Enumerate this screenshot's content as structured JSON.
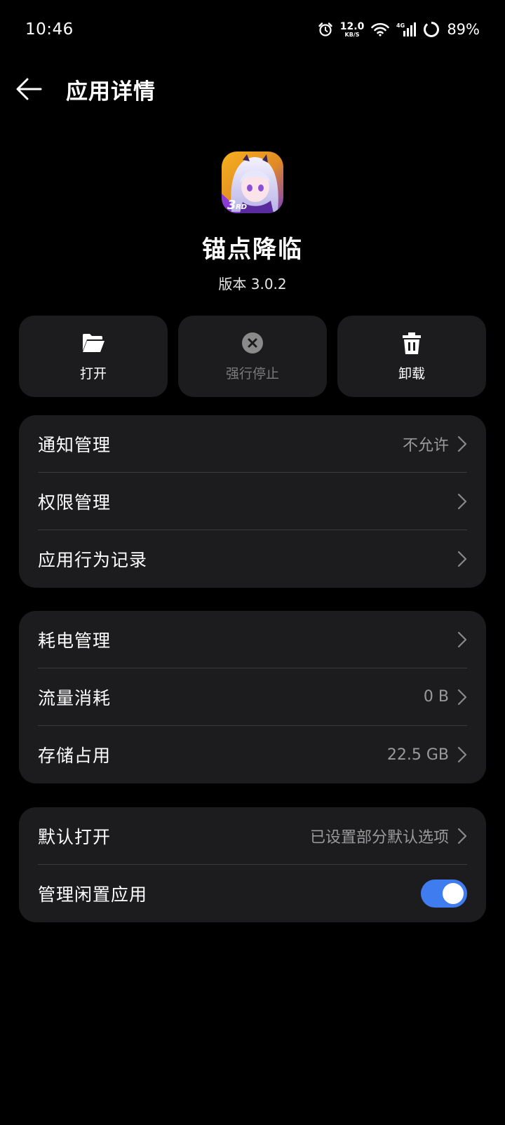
{
  "status_bar": {
    "time": "10:46",
    "net_speed_value": "12.0",
    "net_speed_unit": "KB/S",
    "network_type": "4G",
    "battery": "89%",
    "icons": [
      "alarm-icon",
      "wifi-icon",
      "signal-icon",
      "battery-ring-icon"
    ]
  },
  "header": {
    "title": "应用详情",
    "back_icon": "arrow-left-icon"
  },
  "app": {
    "name": "锚点降临",
    "version": "版本 3.0.2"
  },
  "actions": [
    {
      "label": "打开",
      "icon": "folder-icon",
      "enabled": true
    },
    {
      "label": "强行停止",
      "icon": "close-circle-icon",
      "enabled": false
    },
    {
      "label": "卸载",
      "icon": "trash-icon",
      "enabled": true
    }
  ],
  "group1": [
    {
      "label": "通知管理",
      "value": "不允许"
    },
    {
      "label": "权限管理",
      "value": ""
    },
    {
      "label": "应用行为记录",
      "value": ""
    }
  ],
  "group2": [
    {
      "label": "耗电管理",
      "value": ""
    },
    {
      "label": "流量消耗",
      "value": "0 B"
    },
    {
      "label": "存储占用",
      "value": "22.5 GB"
    }
  ],
  "group3": {
    "default_open": {
      "label": "默认打开",
      "value": "已设置部分默认选项"
    },
    "manage_idle": {
      "label": "管理闲置应用",
      "enabled": true
    }
  },
  "colors": {
    "background": "#000000",
    "card": "#1c1c1e",
    "accent": "#3f7cf0",
    "secondary_text": "#9a9a9a"
  }
}
